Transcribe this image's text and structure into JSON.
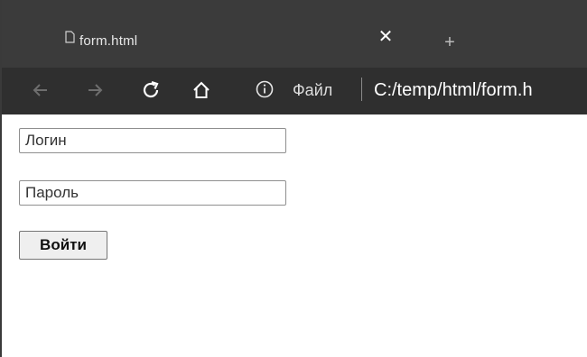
{
  "browser": {
    "tab": {
      "title": "form.html",
      "close_glyph": "✕",
      "favicon_icon": "file-icon"
    },
    "new_tab_glyph": "+",
    "toolbar": {
      "back_icon": "back-arrow-icon",
      "forward_icon": "forward-arrow-icon",
      "reload_icon": "reload-icon",
      "home_icon": "home-icon"
    },
    "address_bar": {
      "info_icon": "info-icon",
      "scheme_label": "Файл",
      "url": "C:/temp/html/form.h"
    },
    "colors": {
      "tabbar_bg": "#3b3b3b",
      "toolbar_bg": "#2f2f2f",
      "text_light": "#e8e8e8"
    }
  },
  "form": {
    "login_placeholder": "Логин",
    "login_value": "",
    "password_placeholder": "Пароль",
    "password_value": "",
    "submit_label": "Войти"
  }
}
